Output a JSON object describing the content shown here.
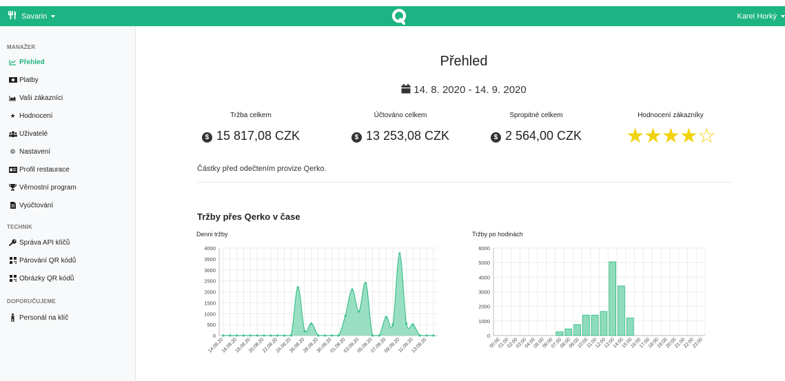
{
  "topbar": {
    "restaurant": "Savarin",
    "user": "Karel Horký"
  },
  "sidebar": {
    "sections": [
      {
        "label": "MANAŽER"
      },
      {
        "label": "TECHNIK"
      },
      {
        "label": "DOPORUČUJEME"
      }
    ],
    "items": [
      {
        "label": "Přehled",
        "icon": "chart-line-icon"
      },
      {
        "label": "Platby",
        "icon": "money-bill-icon"
      },
      {
        "label": "Vaši zákazníci",
        "icon": "chart-area-icon"
      },
      {
        "label": "Hodnocení",
        "icon": "star-icon"
      },
      {
        "label": "Uživatelé",
        "icon": "users-icon"
      },
      {
        "label": "Nastavení",
        "icon": "cogs-icon"
      },
      {
        "label": "Profil restaurace",
        "icon": "id-card-icon"
      },
      {
        "label": "Věrnostní program",
        "icon": "trophy-icon"
      },
      {
        "label": "Vyúčtování",
        "icon": "file-invoice-icon"
      },
      {
        "label": "Správa API klíčů",
        "icon": "key-icon"
      },
      {
        "label": "Párování QR kódů",
        "icon": "qrcode-icon"
      },
      {
        "label": "Obrázky QR kódů",
        "icon": "qrcode-icon"
      },
      {
        "label": "Personál na klíč",
        "icon": "person-icon"
      }
    ]
  },
  "main": {
    "title": "Přehled",
    "date_range": "14. 8. 2020 - 14. 9. 2020",
    "stats": [
      {
        "label": "Tržba celkem",
        "value": "15 817,08 CZK"
      },
      {
        "label": "Účtováno celkem",
        "value": "13 253,08 CZK"
      },
      {
        "label": "Spropitné celkem",
        "value": "2 564,00 CZK"
      },
      {
        "label": "Hodnocení zákazníky",
        "rating": 4,
        "max": 5
      }
    ],
    "note": "Částky před odečtením provize Qerko.",
    "section_title": "Tržby přes Qerko v čase"
  },
  "colors": {
    "brand": "#1cb482",
    "series_fill": "#8fdcbc",
    "series_line": "#3cc08c",
    "star": "#f2d310"
  },
  "chart_data": [
    {
      "type": "area",
      "title": "Denni tržby",
      "ylim": [
        0,
        4000
      ],
      "yticks": [
        0,
        500,
        1000,
        1500,
        2000,
        2500,
        3000,
        3500,
        4000
      ],
      "xticklabels": [
        "14.08.20",
        "16.08.20",
        "18.08.20",
        "20.08.20",
        "22.08.20",
        "24.08.20",
        "26.08.20",
        "28.08.20",
        "30.08.20",
        "01.09.20",
        "03.09.20",
        "05.09.20",
        "07.09.20",
        "09.09.20",
        "11.09.20",
        "13.09.20"
      ],
      "x": [
        "14.08.20",
        "15.08.20",
        "16.08.20",
        "17.08.20",
        "18.08.20",
        "19.08.20",
        "20.08.20",
        "21.08.20",
        "22.08.20",
        "23.08.20",
        "24.08.20",
        "25.08.20",
        "26.08.20",
        "27.08.20",
        "28.08.20",
        "29.08.20",
        "30.08.20",
        "31.08.20",
        "01.09.20",
        "02.09.20",
        "03.09.20",
        "04.09.20",
        "05.09.20",
        "06.09.20",
        "07.09.20",
        "08.09.20",
        "09.09.20",
        "10.09.20",
        "11.09.20",
        "12.09.20",
        "13.09.20",
        "14.09.20"
      ],
      "values": [
        0,
        0,
        0,
        0,
        0,
        0,
        0,
        0,
        0,
        0,
        0,
        2200,
        200,
        550,
        0,
        0,
        0,
        0,
        900,
        2100,
        1100,
        2400,
        0,
        0,
        850,
        500,
        3750,
        550,
        500,
        0,
        0,
        0
      ]
    },
    {
      "type": "bar",
      "title": "Tržby po hodinách",
      "ylim": [
        0,
        6000
      ],
      "yticks": [
        0,
        1000,
        2000,
        3000,
        4000,
        5000,
        6000
      ],
      "categories": [
        "00:00",
        "01:00",
        "02:00",
        "03:00",
        "04:00",
        "05:00",
        "06:00",
        "07:00",
        "08:00",
        "09:00",
        "10:00",
        "11:00",
        "12:00",
        "13:00",
        "14:00",
        "15:00",
        "16:00",
        "17:00",
        "18:00",
        "19:00",
        "20:00",
        "21:00",
        "22:00",
        "23:00"
      ],
      "values": [
        0,
        0,
        0,
        0,
        0,
        0,
        0,
        250,
        450,
        750,
        1400,
        1400,
        1650,
        5050,
        3400,
        1200,
        0,
        0,
        0,
        0,
        0,
        0,
        0,
        0
      ]
    }
  ]
}
